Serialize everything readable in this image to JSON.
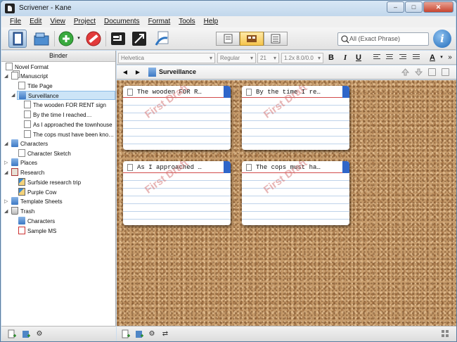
{
  "window": {
    "title": "Scrivener - Kane",
    "minimize_label": "–",
    "maximize_label": "□",
    "close_label": "✕"
  },
  "menu": [
    "File",
    "Edit",
    "View",
    "Project",
    "Documents",
    "Format",
    "Tools",
    "Help"
  ],
  "toolbar": {
    "search_placeholder": "All (Exact Phrase)",
    "help_label": "i"
  },
  "binder": {
    "header": "Binder",
    "items": [
      {
        "label": "Novel Format",
        "icon": "document-icon"
      },
      {
        "label": "Manuscript",
        "icon": "manuscript-icon"
      },
      {
        "label": "Title Page",
        "icon": "document-icon"
      },
      {
        "label": "Surveillance",
        "icon": "folder-icon"
      },
      {
        "label": "The wooden FOR RENT sign",
        "icon": "document-icon"
      },
      {
        "label": "By the time I reached…",
        "icon": "document-icon"
      },
      {
        "label": "As I approached the townhouse",
        "icon": "document-icon"
      },
      {
        "label": "The cops must have been kno…",
        "icon": "document-icon"
      },
      {
        "label": "Characters",
        "icon": "folder-icon"
      },
      {
        "label": "Character Sketch",
        "icon": "document-icon"
      },
      {
        "label": "Places",
        "icon": "folder-icon"
      },
      {
        "label": "Research",
        "icon": "research-icon"
      },
      {
        "label": "Surfside research trip",
        "icon": "image-icon"
      },
      {
        "label": "Purple Cow",
        "icon": "image-icon"
      },
      {
        "label": "Template Sheets",
        "icon": "folder-icon"
      },
      {
        "label": "Trash",
        "icon": "trash-icon"
      },
      {
        "label": "Characters",
        "icon": "folder-icon"
      },
      {
        "label": "Sample MS",
        "icon": "pdf-icon"
      }
    ]
  },
  "formatbar": {
    "font": "Helvetica",
    "style": "Regular",
    "size": "21",
    "spacing": "1.2x 8.0/0.0",
    "bold": "B",
    "italic": "I",
    "underline": "U"
  },
  "header": {
    "title": "Surveillance",
    "back": "◀",
    "forward": "▶"
  },
  "corkboard": {
    "cards": [
      {
        "title": "The wooden FOR R…",
        "status": "First Draft"
      },
      {
        "title": "By the time I re…",
        "status": "First Draft"
      },
      {
        "title": "As I approached …",
        "status": "First Draft"
      },
      {
        "title": "The cops must ha…",
        "status": "First Draft"
      }
    ]
  },
  "colors": {
    "label_tab": "#2f66c9",
    "selection": "#cce4f7",
    "stamp": "#d67878"
  }
}
